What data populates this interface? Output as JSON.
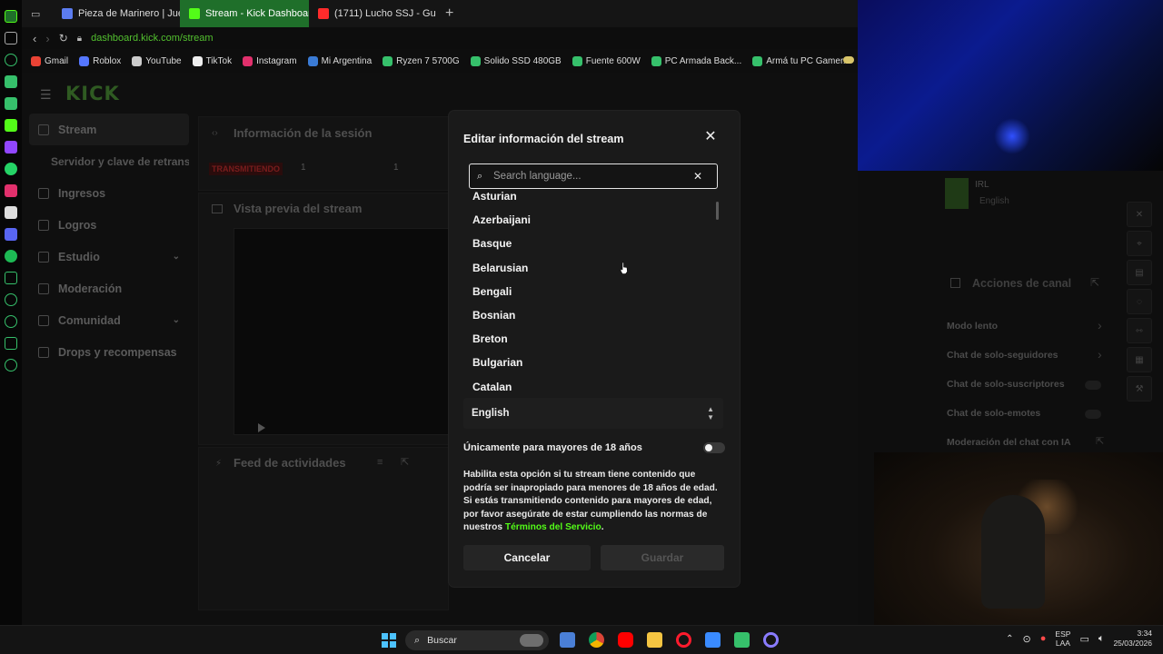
{
  "browser": {
    "tabs": [
      {
        "label": "Pieza de Marinero | Juego",
        "fav_color": "#5b7cf0"
      },
      {
        "label": "Stream - Kick Dashboard",
        "fav_color": "#53fc18"
      },
      {
        "label": "(1711) Lucho SSJ - Gu",
        "fav_color": "#ff2b2b"
      }
    ],
    "url": "dashboard.kick.com/stream",
    "bookmarks": [
      {
        "label": "Gmail",
        "color": "#ea4335"
      },
      {
        "label": "Roblox",
        "color": "#5577ff"
      },
      {
        "label": "YouTube",
        "color": "#cccccc"
      },
      {
        "label": "TikTok",
        "color": "#eeeeee"
      },
      {
        "label": "Instagram",
        "color": "#e1306c"
      },
      {
        "label": "Mi Argentina",
        "color": "#3a7bd5"
      },
      {
        "label": "Ryzen 7 5700G",
        "color": "#36c06b"
      },
      {
        "label": "Solido SSD 480GB",
        "color": "#36c06b"
      },
      {
        "label": "Fuente 600W",
        "color": "#36c06b"
      },
      {
        "label": "PC Armada Back...",
        "color": "#36c06b"
      },
      {
        "label": "Armá tu PC Gamer...",
        "color": "#36c06b"
      }
    ]
  },
  "dashboard": {
    "nav": [
      {
        "label": "Stream",
        "selected": true
      },
      {
        "label": "Servidor y clave de retransn",
        "sub": true
      },
      {
        "label": "Ingresos"
      },
      {
        "label": "Logros"
      },
      {
        "label": "Estudio",
        "expand": true
      },
      {
        "label": "Moderación"
      },
      {
        "label": "Comunidad",
        "expand": true
      },
      {
        "label": "Drops y recompensas"
      }
    ],
    "session_title": "Información de la sesión",
    "status_badge": "TRANSMITIENDO",
    "stat_a": "1",
    "stat_b": "1",
    "preview_title": "Vista previa del stream",
    "feed_title": "Feed de actividades",
    "category": "IRL",
    "category_lang": "English",
    "actions_title": "Acciones de canal",
    "actions": [
      "Modo lento",
      "Chat de solo-seguidores",
      "Chat de solo-suscriptores",
      "Chat de solo-emotes",
      "Moderación del chat con IA"
    ]
  },
  "modal": {
    "title": "Editar información del stream",
    "search_placeholder": "Search language...",
    "languages": [
      "Asturian",
      "Azerbaijani",
      "Basque",
      "Belarusian",
      "Bengali",
      "Bosnian",
      "Breton",
      "Bulgarian",
      "Catalan"
    ],
    "selected_language": "English",
    "adult_label": "Únicamente para mayores de 18 años",
    "adult_enabled": false,
    "description_text": "Habilita esta opción si tu stream tiene contenido que podría ser inapropiado para menores de 18 años de edad. Si estás transmitiendo contenido para mayores de edad, por favor asegúrate de estar cumpliendo las normas de nuestros",
    "tos_link": "Términos del Servicio",
    "tos_end": ".",
    "cancel_label": "Cancelar",
    "save_label": "Guardar"
  },
  "taskbar": {
    "search_label": "Buscar",
    "lang_top": "ESP",
    "lang_bottom": "LAA",
    "time": "3:34",
    "date": "25/03/2026"
  },
  "colors": {
    "kick_green": "#53fc18",
    "modal_bg": "#1a1a1a"
  }
}
